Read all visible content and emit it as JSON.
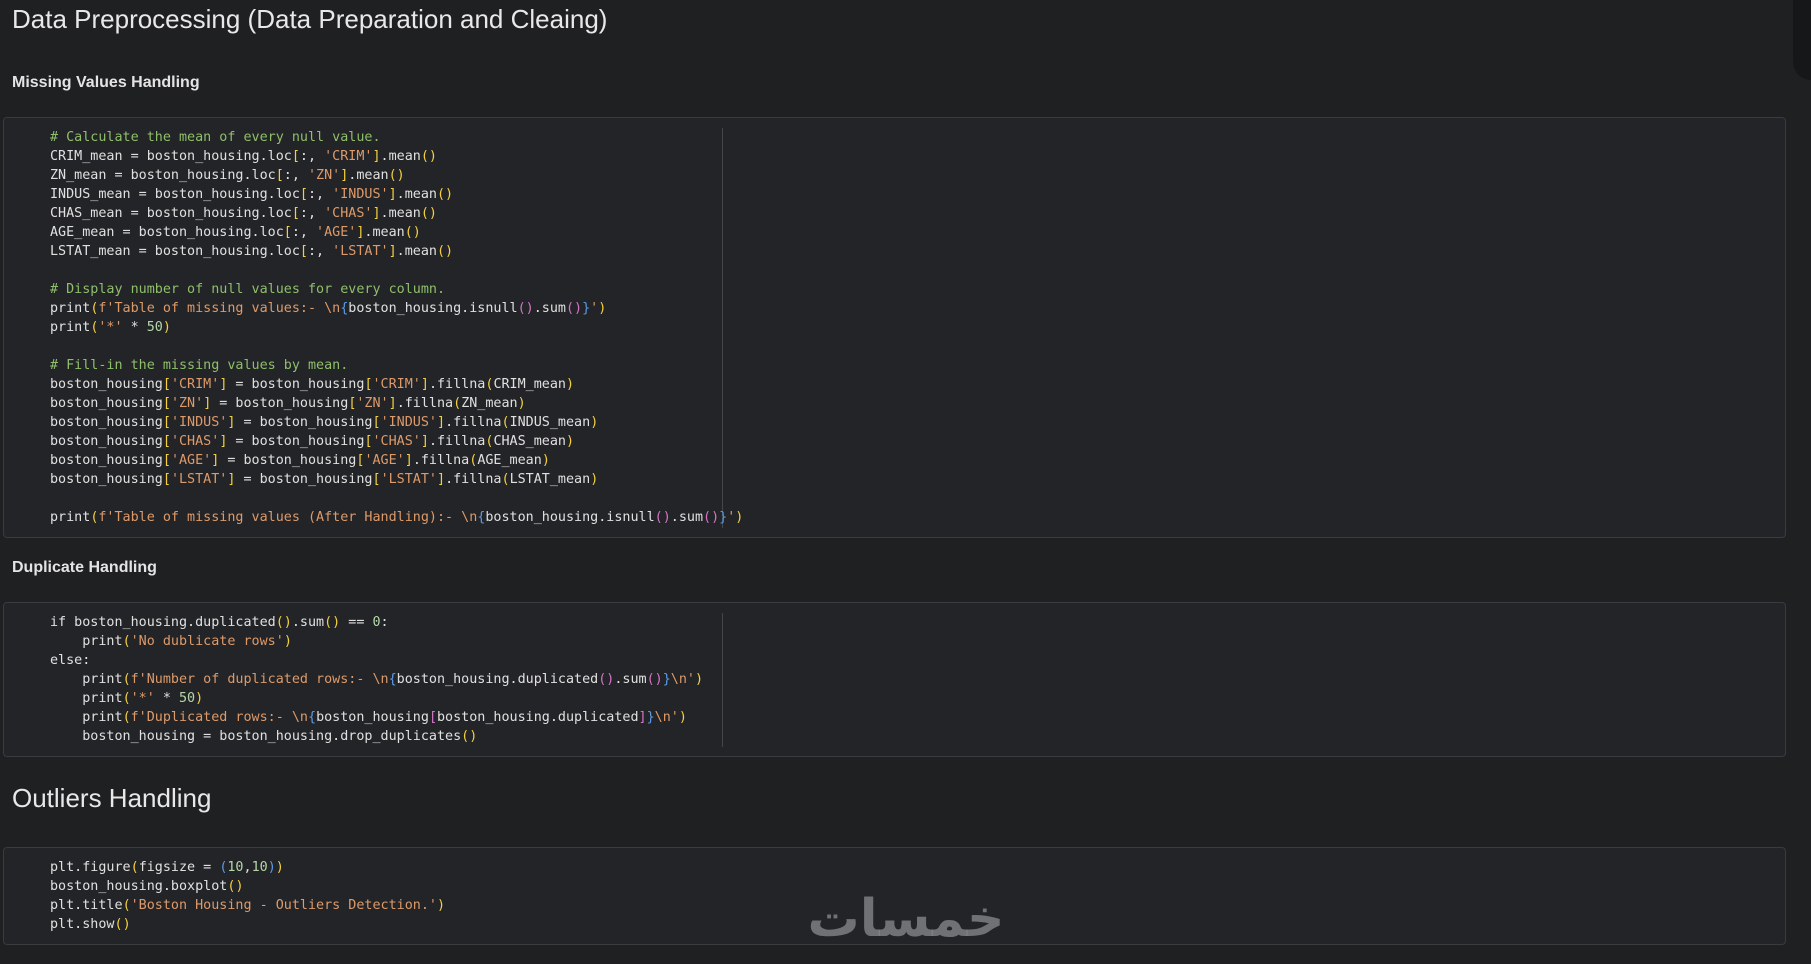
{
  "page_title": "Data Preprocessing (Data Preparation and Cleaing)",
  "sections": {
    "missing": {
      "title": "Missing Values Handling"
    },
    "duplicate": {
      "title": "Duplicate Handling"
    },
    "outliers": {
      "title": "Outliers Handling"
    }
  },
  "cells": {
    "missing_code": [
      "# Calculate the mean of every null value.",
      "CRIM_mean = boston_housing.loc[:, 'CRIM'].mean()",
      "ZN_mean = boston_housing.loc[:, 'ZN'].mean()",
      "INDUS_mean = boston_housing.loc[:, 'INDUS'].mean()",
      "CHAS_mean = boston_housing.loc[:, 'CHAS'].mean()",
      "AGE_mean = boston_housing.loc[:, 'AGE'].mean()",
      "LSTAT_mean = boston_housing.loc[:, 'LSTAT'].mean()",
      "",
      "# Display number of null values for every column.",
      "print(f'Table of missing values:- \\n{boston_housing.isnull().sum()}')",
      "print('*' * 50)",
      "",
      "# Fill-in the missing values by mean.",
      "boston_housing['CRIM'] = boston_housing['CRIM'].fillna(CRIM_mean)",
      "boston_housing['ZN'] = boston_housing['ZN'].fillna(ZN_mean)",
      "boston_housing['INDUS'] = boston_housing['INDUS'].fillna(INDUS_mean)",
      "boston_housing['CHAS'] = boston_housing['CHAS'].fillna(CHAS_mean)",
      "boston_housing['AGE'] = boston_housing['AGE'].fillna(AGE_mean)",
      "boston_housing['LSTAT'] = boston_housing['LSTAT'].fillna(LSTAT_mean)",
      "",
      "print(f'Table of missing values (After Handling):- \\n{boston_housing.isnull().sum()}')"
    ],
    "duplicate_code": [
      "if boston_housing.duplicated().sum() == 0:",
      "    print('No dublicate rows')",
      "else:",
      "    print(f'Number of duplicated rows:- \\n{boston_housing.duplicated().sum()}\\n')",
      "    print('*' * 50)",
      "    print(f'Duplicated rows:- \\n{boston_housing[boston_housing.duplicated]}\\n')",
      "    boston_housing = boston_housing.drop_duplicates()"
    ],
    "outliers_code": [
      "plt.figure(figsize = (10,10))",
      "boston_housing.boxplot()",
      "plt.title('Boston Housing - Outliers Detection.')",
      "plt.show()"
    ]
  },
  "colors": {
    "background": "#1f2022",
    "cell_background": "#232427",
    "comment": "#8fbf6a",
    "string": "#dd9a6a",
    "bracket_1": "#f4d03f",
    "bracket_2": "#5b9be6",
    "bracket_3": "#d474c6"
  },
  "watermark": {
    "icon": "khamsat-logo-icon",
    "text": "خمسات"
  }
}
